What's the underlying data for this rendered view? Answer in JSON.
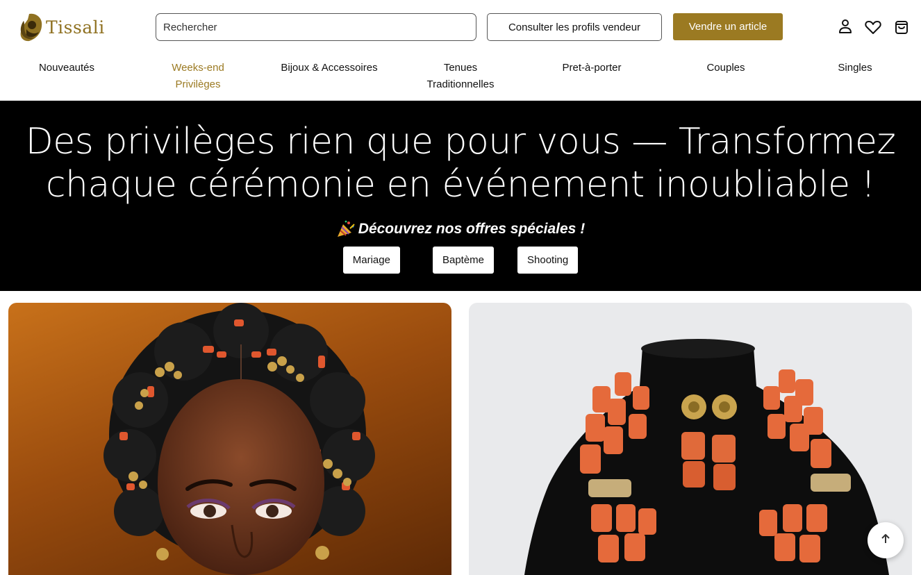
{
  "brand": {
    "name": "Tissali",
    "color": "#8f7121"
  },
  "search": {
    "placeholder": "Rechercher"
  },
  "header": {
    "profiles_button": "Consulter les profils vendeur",
    "sell_button": "Vendre un article",
    "icons": [
      "user-icon",
      "heart-icon",
      "shopping-bag-icon"
    ]
  },
  "nav": {
    "items": [
      {
        "label": "Nouveautés"
      },
      {
        "label": "Weeks-end\nPrivilèges",
        "active": true
      },
      {
        "label": "Bijoux & Accessoires"
      },
      {
        "label": "Tenues\nTraditionnelles"
      },
      {
        "label": "Pret-à-porter"
      },
      {
        "label": "Couples"
      },
      {
        "label": "Singles"
      }
    ],
    "active_color": "#9b7a22"
  },
  "hero": {
    "title_line1": "Des privilèges rien que pour vous — Transformez",
    "title_line2": "chaque cérémonie en événement inoubliable !",
    "subtitle": "Découvrez nos offres spéciales !",
    "subtitle_icon": "party-popper-icon",
    "buttons": [
      "Mariage",
      "Baptème",
      "Shooting"
    ],
    "background": "#000000"
  },
  "products": [
    {
      "image": "bride-coral-hairstyle-photo"
    },
    {
      "image": "coral-bead-necklace-earrings-photo"
    }
  ],
  "accent_color": "#9b7a22"
}
